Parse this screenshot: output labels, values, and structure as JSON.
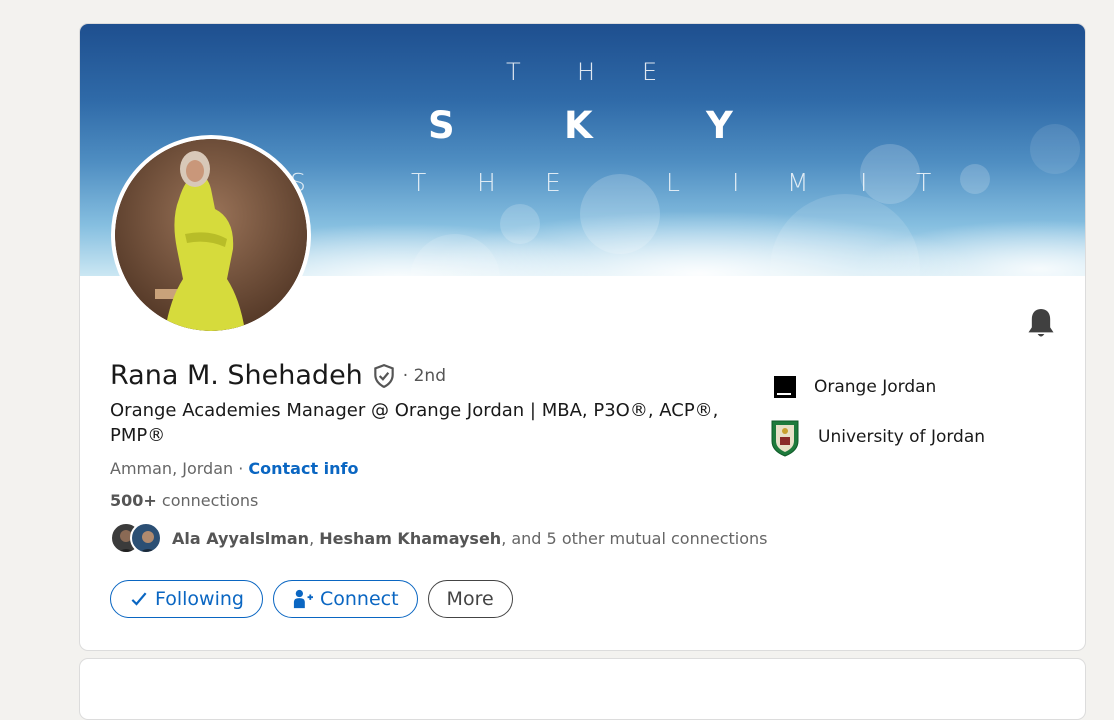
{
  "banner": {
    "line1": "THE",
    "line2": "SKY",
    "line3": "STHE LIMIT"
  },
  "profile": {
    "name": "Rana M. Shehadeh",
    "degree": "· 2nd",
    "headline": "Orange Academies Manager @ Orange Jordan | MBA, P3O®, ACP®, PMP®",
    "location": "Amman, Jordan",
    "location_sep": " · ",
    "contact_info": "Contact info",
    "connections_count": "500+",
    "connections_label": " connections",
    "mutual_name1": "Ala Ayyalslman",
    "mutual_sep": ", ",
    "mutual_name2": "Hesham Khamayseh",
    "mutual_rest": ", and 5 other mutual connections"
  },
  "actions": {
    "following": "Following",
    "connect": "Connect",
    "more": "More"
  },
  "right_column": {
    "company": "Orange Jordan",
    "school": "University of Jordan"
  },
  "colors": {
    "accent": "#0a66c2",
    "page_bg": "#f3f2ef"
  },
  "icons": [
    "bell-icon",
    "verified-shield-icon",
    "checkmark-icon",
    "add-person-icon",
    "orange-logo-icon",
    "university-crest-icon"
  ]
}
